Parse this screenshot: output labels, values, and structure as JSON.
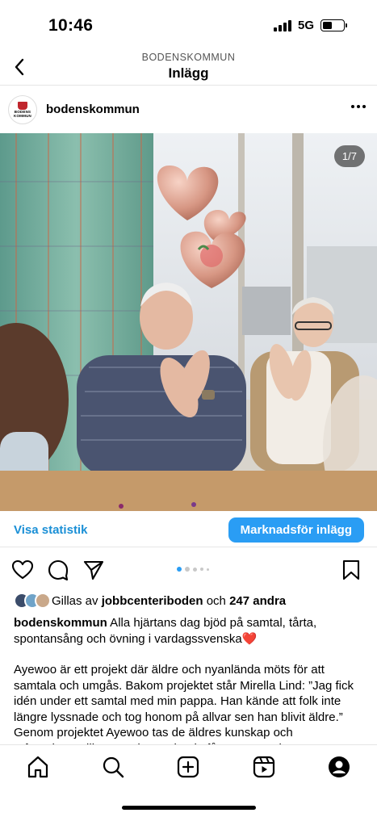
{
  "status_bar": {
    "time": "10:46",
    "network": "5G"
  },
  "header": {
    "account": "BODENSKOMMUN",
    "title": "Inlägg"
  },
  "profile": {
    "name": "bodenskommun",
    "avatar_text_line1": "BODENS",
    "avatar_text_line2": "KOMMUN",
    "avatar_color": "#c0262d"
  },
  "photo": {
    "counter": "1/7",
    "slide_index": 1,
    "slide_count": 7
  },
  "actions": {
    "insights_label": "Visa statistik",
    "promote_label": "Marknadsför inlägg",
    "accent_color": "#2a9df4",
    "icons": [
      "heart-icon",
      "comment-icon",
      "share-icon",
      "bookmark-icon"
    ]
  },
  "likes": {
    "prefix": "Gillas av",
    "user": "jobbcenteriboden",
    "connector": "och",
    "others": "247 andra"
  },
  "caption": {
    "username": "bodenskommun",
    "first_line": " Alla hjärtans dag bjöd på samtal, tårta, spontansång och övning i vardagssvenska",
    "emoji": "❤️",
    "paragraph": "Ayewoo är ett projekt där äldre och nyanlända möts för att samtala och umgås. Bakom projektet står Mirella Lind: ”Jag fick idén under ett samtal med min pappa. Han kände att folk inte längre lyssnade och tog honom på allvar sen han blivit äldre.” Genom projektet Ayewoo tas de äldres kunskap och erfarenheter till vara och nyanlända får öva svenska."
  },
  "bottom_nav": [
    "home-icon",
    "search-icon",
    "create-icon",
    "reels-icon",
    "profile-icon"
  ]
}
